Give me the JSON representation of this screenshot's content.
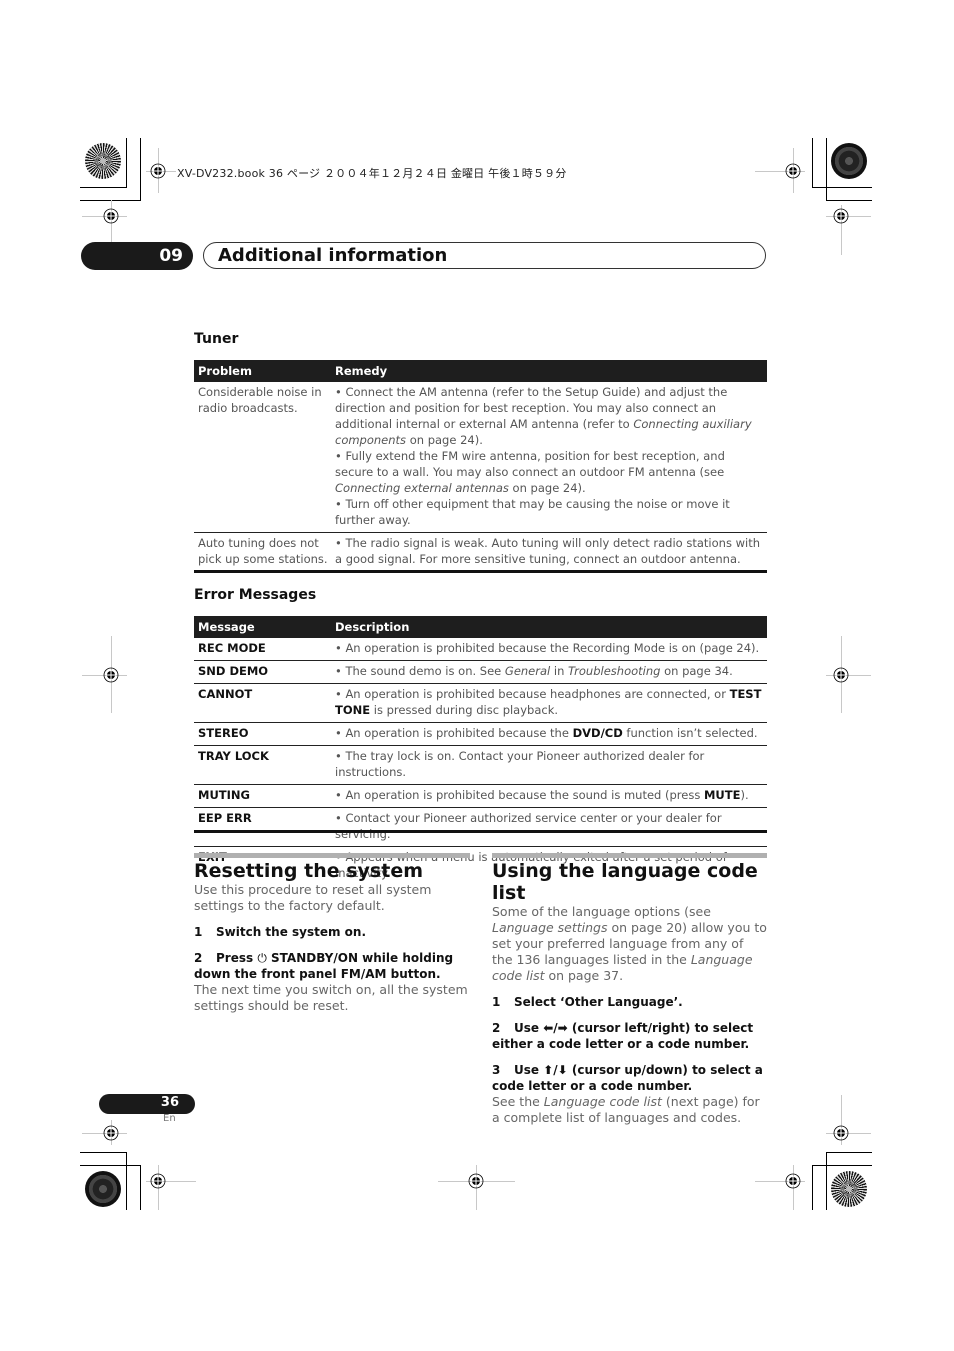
{
  "print_header": {
    "text": "XV-DV232.book  36 ページ  ２００４年１２月２４日  金曜日  午後１時５９分"
  },
  "chapter": {
    "number": "09",
    "title": "Additional information"
  },
  "tuner": {
    "heading": "Tuner",
    "columns": [
      "Problem",
      "Remedy"
    ],
    "rows": [
      {
        "problem": "Considerable noise in radio broadcasts.",
        "remedy": [
          {
            "pre": "• Connect the AM antenna (refer to the Setup Guide) and adjust the direction and position for best reception. You may also connect an additional internal or external AM antenna (refer to ",
            "em": "Connecting auxiliary components",
            "post": " on page 24)."
          },
          {
            "pre": "• Fully extend the FM wire antenna, position for best reception, and secure to a wall. You may also connect an outdoor FM antenna (see ",
            "em": "Connecting external antennas",
            "post": " on page 24)."
          },
          {
            "pre": "• Turn off other equipment that may be causing the noise or move it further away.",
            "em": "",
            "post": ""
          }
        ]
      },
      {
        "problem": "Auto tuning does not pick up some stations.",
        "remedy": [
          {
            "pre": "• The radio signal is weak. Auto tuning will only detect radio stations with a good signal. For more sensitive tuning, connect an outdoor antenna.",
            "em": "",
            "post": ""
          }
        ]
      }
    ]
  },
  "errors": {
    "heading": "Error Messages",
    "columns": [
      "Message",
      "Description"
    ],
    "rows": [
      {
        "message": "REC MODE",
        "d1": "• An operation is prohibited because the Recording Mode is on (page 24).",
        "b": "",
        "d2": "",
        "i1": "",
        "m": "",
        "i2": "",
        "d3": ""
      },
      {
        "message": "SND DEMO",
        "d1": "• The sound demo is on. See ",
        "i1": "General",
        "m": " in ",
        "i2": "Troubleshooting",
        "d3": " on page 34.",
        "b": "",
        "d2": ""
      },
      {
        "message": "CANNOT",
        "d1": "• An operation is prohibited because headphones are connected, or ",
        "b": "TEST TONE",
        "d2": " is pressed during disc playback.",
        "i1": "",
        "m": "",
        "i2": "",
        "d3": ""
      },
      {
        "message": "STEREO",
        "d1": "• An operation is prohibited because the ",
        "b": "DVD/CD",
        "d2": " function isn’t selected.",
        "i1": "",
        "m": "",
        "i2": "",
        "d3": ""
      },
      {
        "message": "TRAY LOCK",
        "d1": "• The tray lock is on. Contact your Pioneer authorized dealer for instructions.",
        "b": "",
        "d2": "",
        "i1": "",
        "m": "",
        "i2": "",
        "d3": ""
      },
      {
        "message": "MUTING",
        "d1": "• An operation is prohibited because the sound is muted (press ",
        "b": "MUTE",
        "d2": ").",
        "i1": "",
        "m": "",
        "i2": "",
        "d3": ""
      },
      {
        "message": "EEP ERR",
        "d1": "• Contact your Pioneer authorized service center or your dealer for servicing.",
        "b": "",
        "d2": "",
        "i1": "",
        "m": "",
        "i2": "",
        "d3": ""
      },
      {
        "message": "EXIT",
        "d1": "• Appears when a menu is automatically exited after a set period of inactivity.",
        "b": "",
        "d2": "",
        "i1": "",
        "m": "",
        "i2": "",
        "d3": ""
      }
    ]
  },
  "resetting": {
    "heading": "Resetting the system",
    "intro": "Use this procedure to reset all system settings to the factory default.",
    "step1_num": "1",
    "step1": "Switch the system on.",
    "step2_num": "2",
    "step2_pre": "Press ",
    "step2_icon": "⏻",
    "step2_post": " STANDBY/ON while holding down the front panel FM/AM button.",
    "after": "The next time you switch on, all the system settings should be reset."
  },
  "language": {
    "heading": "Using the language code list",
    "intro_1": "Some of the language options (see ",
    "intro_em1": "Language settings",
    "intro_2": " on page 20) allow you to set your preferred language from any of the 136 languages listed in the ",
    "intro_em2": "Language code list",
    "intro_3": " on page 37.",
    "step1_num": "1",
    "step1": "Select ‘Other Language’.",
    "step2_num": "2",
    "step2_pre": "Use ",
    "step2_icons": "⬅/➡",
    "step2_post": " (cursor left/right) to select either a code letter or a code number.",
    "step3_num": "3",
    "step3_pre": "Use ",
    "step3_icons": "⬆/⬇",
    "step3_post": " (cursor up/down) to select a code letter or a code number.",
    "after_1": "See the ",
    "after_em": "Language code list",
    "after_2": " (next page) for a complete list of languages and codes."
  },
  "footer": {
    "page_number": "36",
    "language": "En"
  }
}
